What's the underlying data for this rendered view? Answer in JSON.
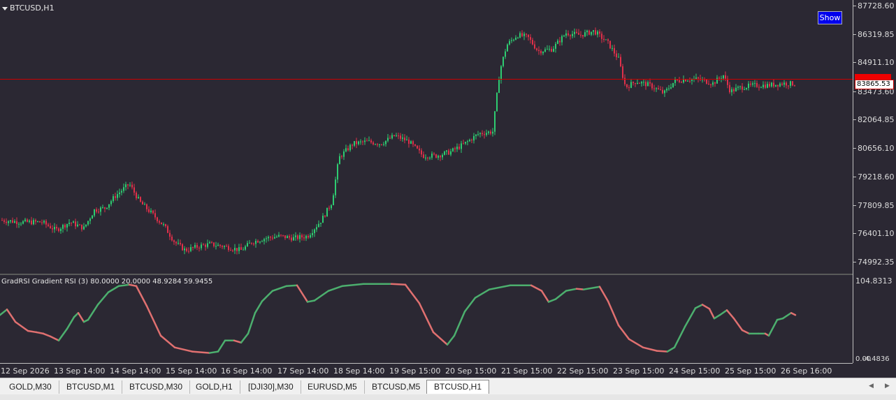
{
  "symbol_label": "BTCUSD,H1",
  "show_button": "Show",
  "indicator_label": "GradRSI Gradient RSI (3) 80.0000 20.0000 48.9284 59.9455",
  "price_axis": [
    "87728.60",
    "86319.85",
    "84911.10",
    "83473.60",
    "82064.85",
    "80656.10",
    "79218.60",
    "77809.85",
    "76401.10",
    "74992.35"
  ],
  "bid_price": "83865.53",
  "rsi_axis": {
    "top": "104.8313",
    "bottom_a": "0.00",
    "bottom_b": "-4.4836"
  },
  "time_axis": [
    "12 Sep 2026",
    "13 Sep 14:00",
    "14 Sep 14:00",
    "15 Sep 14:00",
    "16 Sep 14:00",
    "17 Sep 14:00",
    "18 Sep 14:00",
    "19 Sep 15:00",
    "20 Sep 15:00",
    "21 Sep 15:00",
    "22 Sep 15:00",
    "23 Sep 15:00",
    "24 Sep 15:00",
    "25 Sep 15:00",
    "26 Sep 16:00"
  ],
  "tabs": [
    "GOLD,M30",
    "BTCUSD,M1",
    "BTCUSD,M30",
    "GOLD,H1",
    "[DJI30],M30",
    "EURUSD,M5",
    "BTCUSD,M5",
    "BTCUSD,H1"
  ],
  "active_tab": "BTCUSD,H1",
  "colors": {
    "background": "#2b2833",
    "bull": "#2ecc71",
    "bear": "#e0304a",
    "bid_line": "#cc0000",
    "rsi_up": "#4caf6e",
    "rsi_down": "#e07070"
  },
  "chart_data": {
    "type": "candlestick",
    "x_range": [
      "12 Sep 2026",
      "26 Sep 16:00"
    ],
    "y_range": [
      74992.35,
      87728.6
    ],
    "bid": 83865.53,
    "close_path": [
      [
        0,
        77100
      ],
      [
        30,
        77000
      ],
      [
        60,
        77000
      ],
      [
        80,
        76600
      ],
      [
        100,
        77000
      ],
      [
        120,
        76700
      ],
      [
        135,
        77600
      ],
      [
        150,
        77700
      ],
      [
        165,
        78300
      ],
      [
        185,
        78900
      ],
      [
        200,
        78000
      ],
      [
        215,
        77500
      ],
      [
        235,
        76800
      ],
      [
        250,
        76000
      ],
      [
        265,
        75600
      ],
      [
        285,
        75800
      ],
      [
        300,
        75900
      ],
      [
        320,
        75800
      ],
      [
        345,
        75600
      ],
      [
        360,
        76000
      ],
      [
        380,
        76200
      ],
      [
        400,
        76300
      ],
      [
        420,
        76200
      ],
      [
        440,
        76300
      ],
      [
        460,
        77100
      ],
      [
        475,
        78000
      ],
      [
        485,
        80200
      ],
      [
        505,
        80900
      ],
      [
        525,
        81000
      ],
      [
        545,
        80900
      ],
      [
        565,
        81300
      ],
      [
        585,
        81000
      ],
      [
        605,
        80300
      ],
      [
        625,
        80300
      ],
      [
        645,
        80500
      ],
      [
        665,
        80900
      ],
      [
        685,
        81400
      ],
      [
        705,
        81500
      ],
      [
        715,
        84500
      ],
      [
        725,
        85800
      ],
      [
        740,
        86300
      ],
      [
        755,
        86200
      ],
      [
        770,
        85500
      ],
      [
        790,
        85600
      ],
      [
        810,
        86400
      ],
      [
        830,
        86300
      ],
      [
        850,
        86500
      ],
      [
        870,
        85900
      ],
      [
        885,
        85100
      ],
      [
        895,
        83700
      ],
      [
        910,
        84000
      ],
      [
        930,
        83800
      ],
      [
        950,
        83400
      ],
      [
        965,
        84000
      ],
      [
        980,
        84100
      ],
      [
        1000,
        84100
      ],
      [
        1020,
        83900
      ],
      [
        1035,
        84300
      ],
      [
        1045,
        83500
      ],
      [
        1060,
        83700
      ],
      [
        1080,
        83800
      ],
      [
        1100,
        83800
      ],
      [
        1120,
        83900
      ],
      [
        1138,
        83870
      ]
    ]
  },
  "rsi_data": {
    "range": [
      -4.4836,
      104.8313
    ],
    "levels": [
      80,
      20
    ],
    "path": [
      [
        0,
        55
      ],
      [
        10,
        63
      ],
      [
        22,
        45
      ],
      [
        40,
        32
      ],
      [
        52,
        30
      ],
      [
        62,
        28
      ],
      [
        72,
        24
      ],
      [
        84,
        18
      ],
      [
        96,
        35
      ],
      [
        106,
        52
      ],
      [
        112,
        58
      ],
      [
        120,
        45
      ],
      [
        126,
        48
      ],
      [
        140,
        70
      ],
      [
        155,
        88
      ],
      [
        170,
        97
      ],
      [
        185,
        99
      ],
      [
        195,
        97
      ],
      [
        210,
        68
      ],
      [
        230,
        25
      ],
      [
        250,
        8
      ],
      [
        275,
        2
      ],
      [
        300,
        0
      ],
      [
        312,
        2
      ],
      [
        322,
        18
      ],
      [
        335,
        18
      ],
      [
        345,
        15
      ],
      [
        355,
        28
      ],
      [
        365,
        58
      ],
      [
        375,
        75
      ],
      [
        390,
        90
      ],
      [
        410,
        97
      ],
      [
        425,
        98
      ],
      [
        440,
        74
      ],
      [
        450,
        76
      ],
      [
        470,
        90
      ],
      [
        490,
        97
      ],
      [
        520,
        100
      ],
      [
        560,
        100
      ],
      [
        580,
        99
      ],
      [
        600,
        72
      ],
      [
        620,
        30
      ],
      [
        640,
        12
      ],
      [
        650,
        25
      ],
      [
        665,
        60
      ],
      [
        680,
        80
      ],
      [
        700,
        92
      ],
      [
        730,
        98
      ],
      [
        760,
        98
      ],
      [
        775,
        90
      ],
      [
        785,
        74
      ],
      [
        795,
        78
      ],
      [
        810,
        90
      ],
      [
        825,
        93
      ],
      [
        835,
        92
      ],
      [
        858,
        96
      ],
      [
        870,
        75
      ],
      [
        885,
        40
      ],
      [
        900,
        20
      ],
      [
        920,
        8
      ],
      [
        940,
        3
      ],
      [
        955,
        2
      ],
      [
        965,
        8
      ],
      [
        980,
        38
      ],
      [
        995,
        65
      ],
      [
        1005,
        70
      ],
      [
        1015,
        64
      ],
      [
        1022,
        50
      ],
      [
        1030,
        55
      ],
      [
        1040,
        62
      ],
      [
        1050,
        50
      ],
      [
        1062,
        33
      ],
      [
        1072,
        28
      ],
      [
        1085,
        28
      ],
      [
        1095,
        28
      ],
      [
        1100,
        25
      ],
      [
        1112,
        48
      ],
      [
        1120,
        50
      ],
      [
        1132,
        58
      ],
      [
        1138,
        55
      ]
    ]
  }
}
